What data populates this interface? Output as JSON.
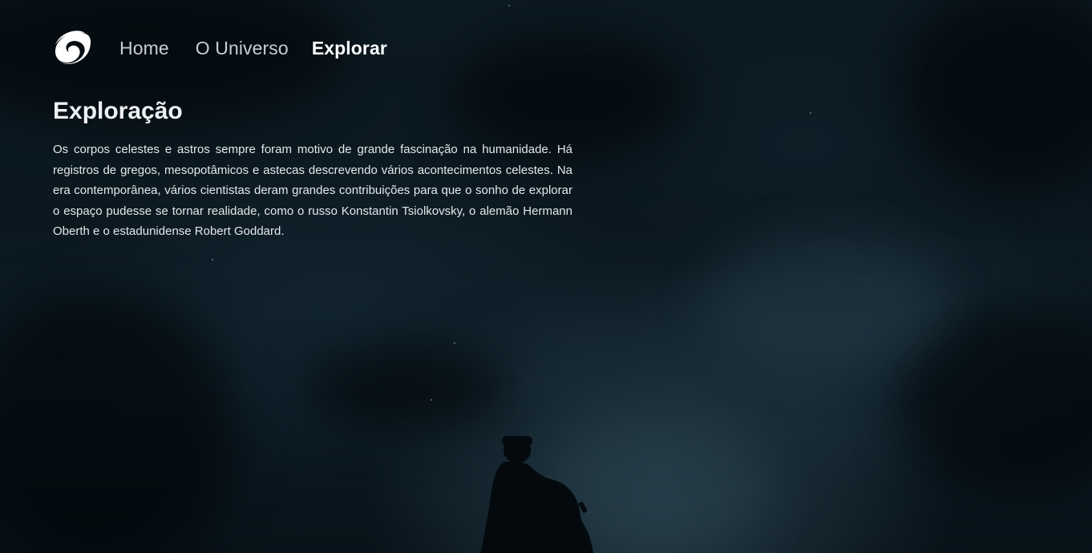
{
  "nav": {
    "logo_icon": "spiral-galaxy-icon",
    "items": [
      {
        "label": "Home",
        "active": false
      },
      {
        "label": "O Universo",
        "active": false
      },
      {
        "label": "Explorar",
        "active": true
      }
    ]
  },
  "main": {
    "title": "Exploração",
    "paragraph": "Os corpos celestes e astros sempre foram motivo de grande fascinação na humanidade. Há registros de gregos, mesopotâmicos e astecas descrevendo vários acontecimentos celestes. Na era contemporânea, vários cientistas deram grandes contribuições para que o sonho de explorar o espaço pudesse se tornar realidade, como o russo Konstantin Tsiolkovsky, o alemão Hermann Oberth e o estadunidense Robert Goddard."
  },
  "colors": {
    "background": "#0b1820",
    "nav_text": "#c9ced2",
    "nav_active": "#ffffff",
    "body_text": "#e4e8ea"
  }
}
